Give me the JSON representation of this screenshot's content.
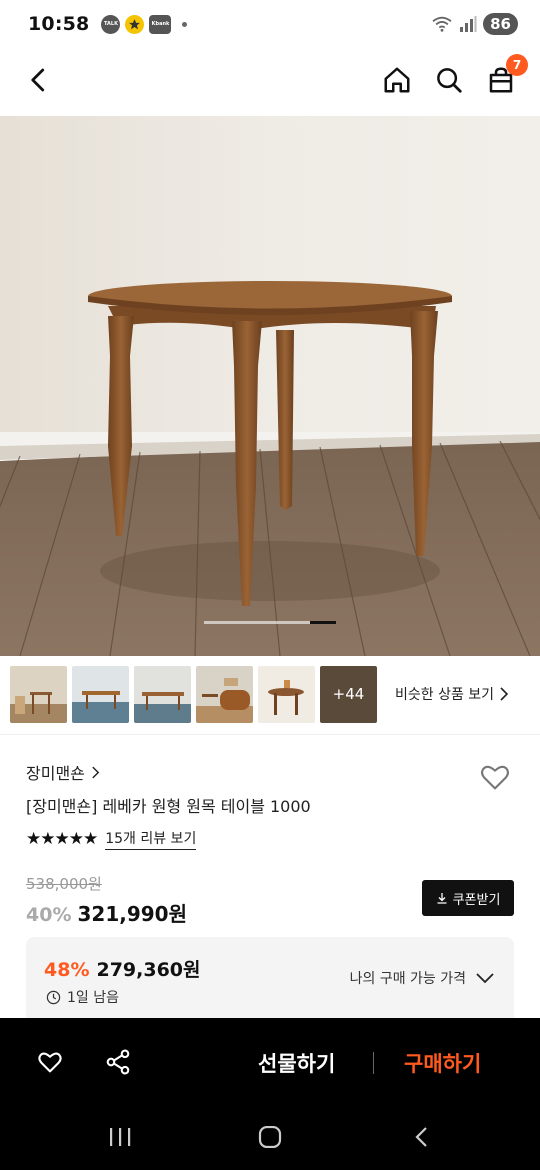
{
  "status_bar": {
    "time": "10:58",
    "talk_label": "TALK",
    "kbank_label": "Kbank",
    "battery": "86"
  },
  "header": {
    "cart_count": "7"
  },
  "gallery": {
    "more_count": "+44",
    "similar_label": "비슷한 상품 보기"
  },
  "product": {
    "brand": "장미맨숀",
    "title": "[장미맨숀] 레베카 원형 원목 테이블 1000",
    "rating_stars": 5,
    "review_label": "15개 리뷰 보기",
    "original_price": "538,000원",
    "discount": "40%",
    "price": "321,990원",
    "coupon_label": "쿠폰받기"
  },
  "my_price": {
    "discount": "48%",
    "price": "279,360원",
    "time_left": "1일 남음",
    "label": "나의 구매 가능 가격"
  },
  "actions": {
    "gift_label": "선물하기",
    "buy_label": "구매하기"
  },
  "colors": {
    "accent": "#ff5a1f",
    "dark": "#111111"
  }
}
